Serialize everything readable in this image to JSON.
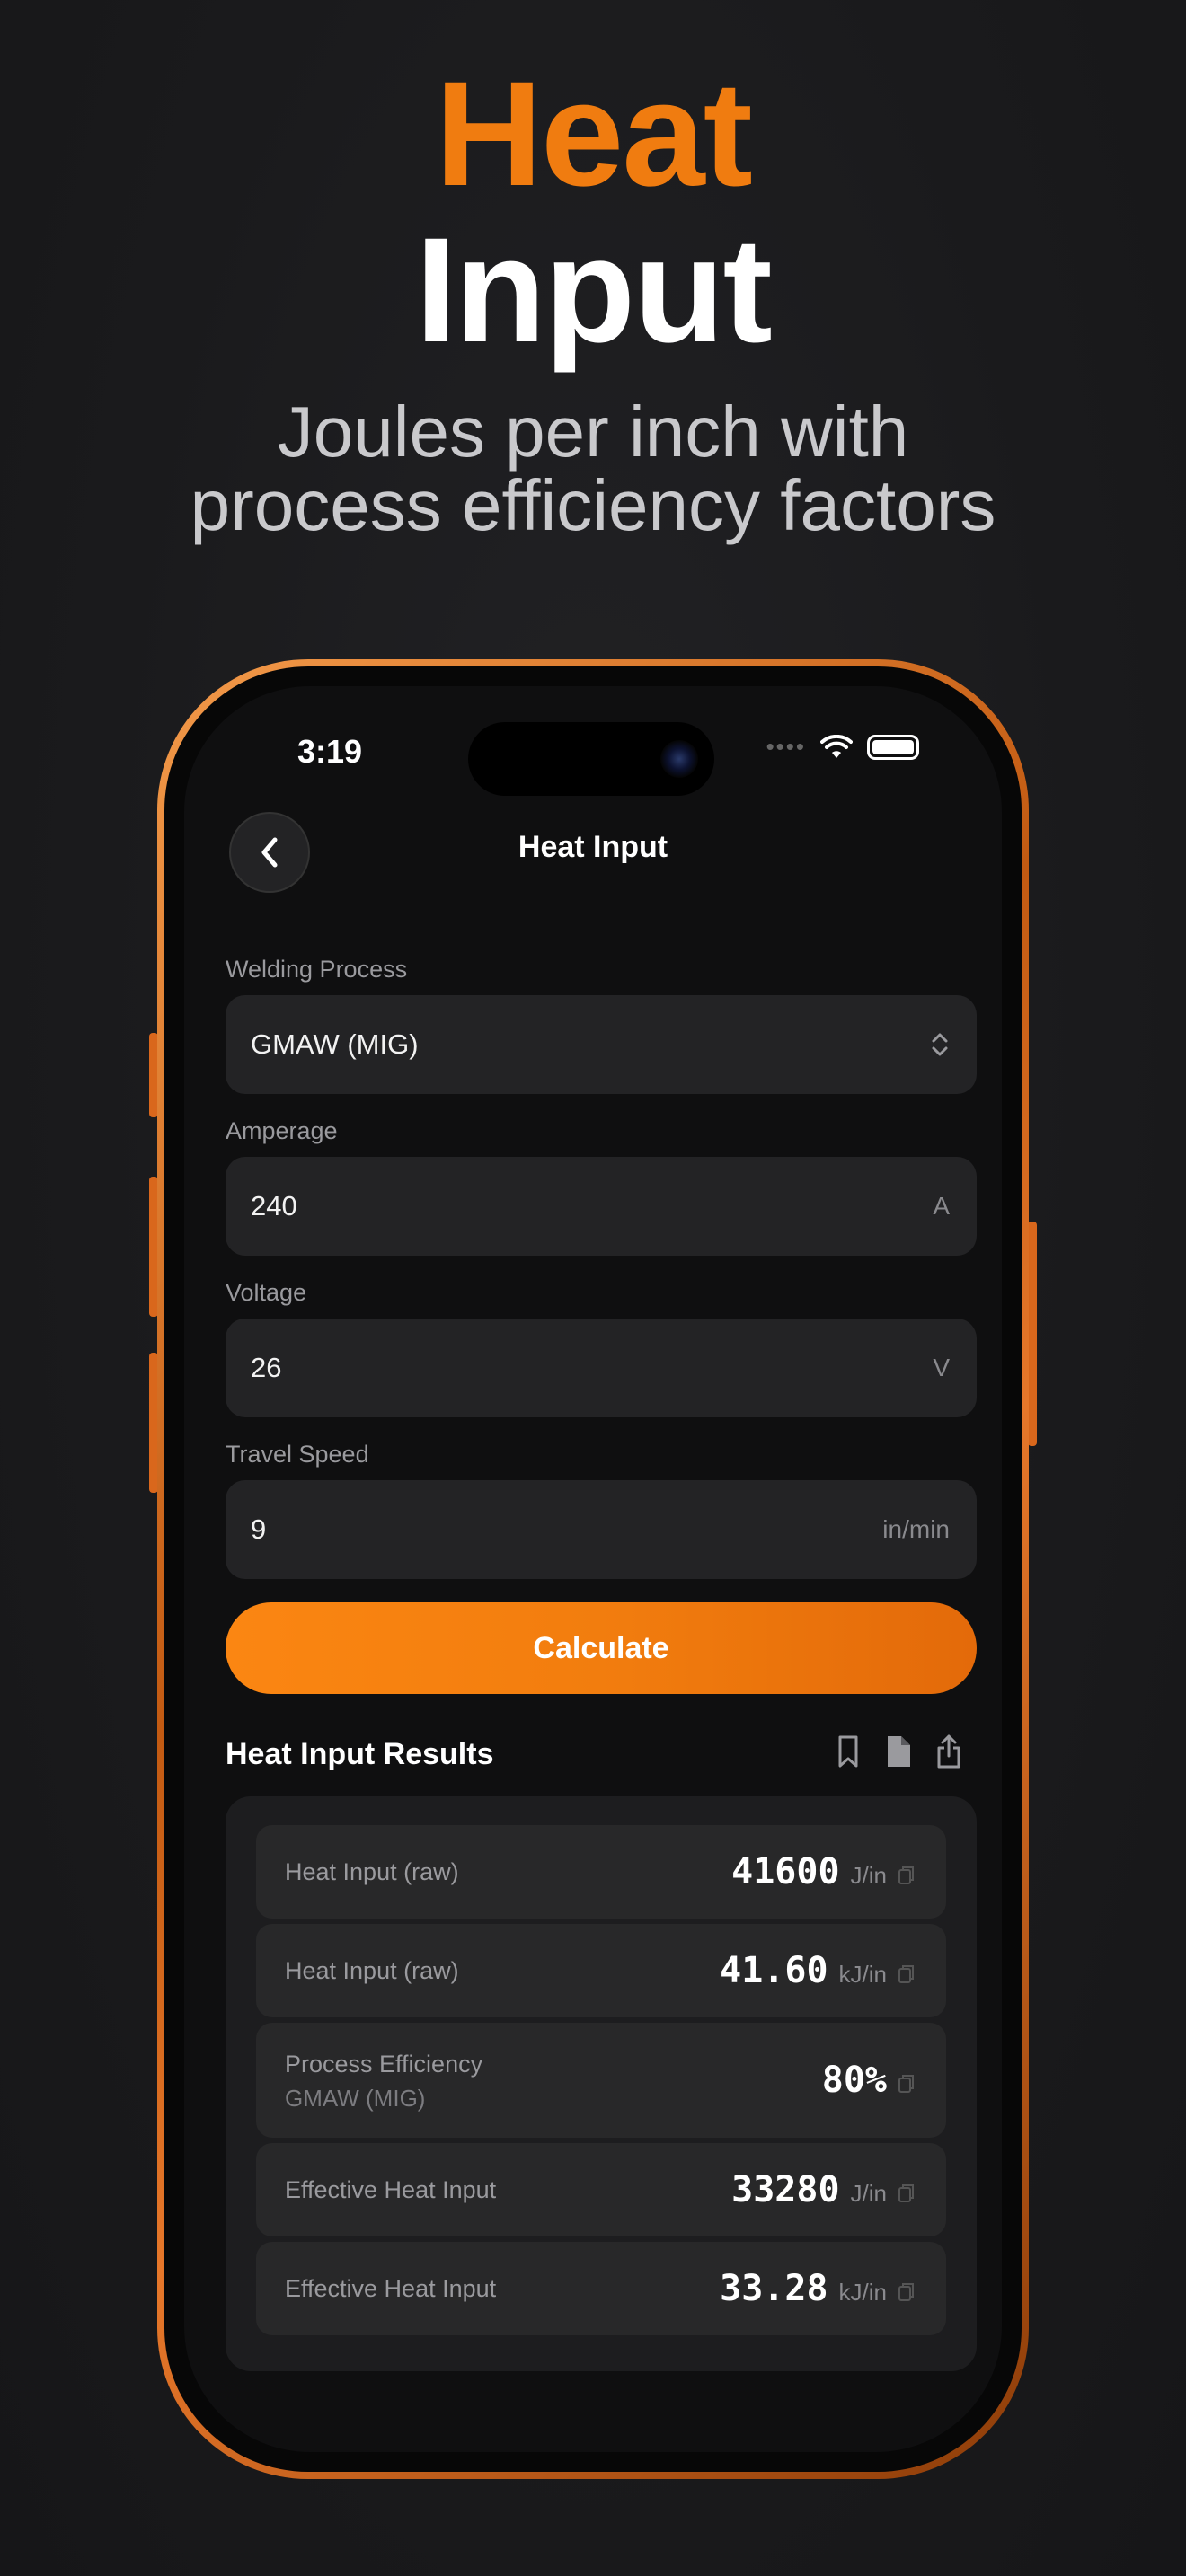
{
  "hero": {
    "title_line1": "Heat",
    "title_line2": "Input",
    "subtitle_line1": "Joules per inch with",
    "subtitle_line2": "process efficiency factors",
    "accent_color": "#f07c10"
  },
  "status_bar": {
    "time": "3:19"
  },
  "nav": {
    "title": "Heat Input",
    "back_icon": "chevron-left-icon"
  },
  "form": {
    "process": {
      "label": "Welding Process",
      "value": "GMAW (MIG)"
    },
    "amperage": {
      "label": "Amperage",
      "value": "240",
      "unit": "A"
    },
    "voltage": {
      "label": "Voltage",
      "value": "26",
      "unit": "V"
    },
    "travel_speed": {
      "label": "Travel Speed",
      "value": "9",
      "unit": "in/min"
    },
    "calculate_label": "Calculate"
  },
  "results": {
    "title": "Heat Input Results",
    "action_icons": [
      "bookmark-icon",
      "document-icon",
      "share-icon"
    ],
    "rows": [
      {
        "label": "Heat Input (raw)",
        "sub": "",
        "value": "41600",
        "unit": "J/in"
      },
      {
        "label": "Heat Input (raw)",
        "sub": "",
        "value": "41.60",
        "unit": "kJ/in"
      },
      {
        "label": "Process Efficiency",
        "sub": "GMAW (MIG)",
        "value": "80%",
        "unit": ""
      },
      {
        "label": "Effective Heat Input",
        "sub": "",
        "value": "33280",
        "unit": "J/in"
      },
      {
        "label": "Effective Heat Input",
        "sub": "",
        "value": "33.28",
        "unit": "kJ/in"
      }
    ]
  }
}
